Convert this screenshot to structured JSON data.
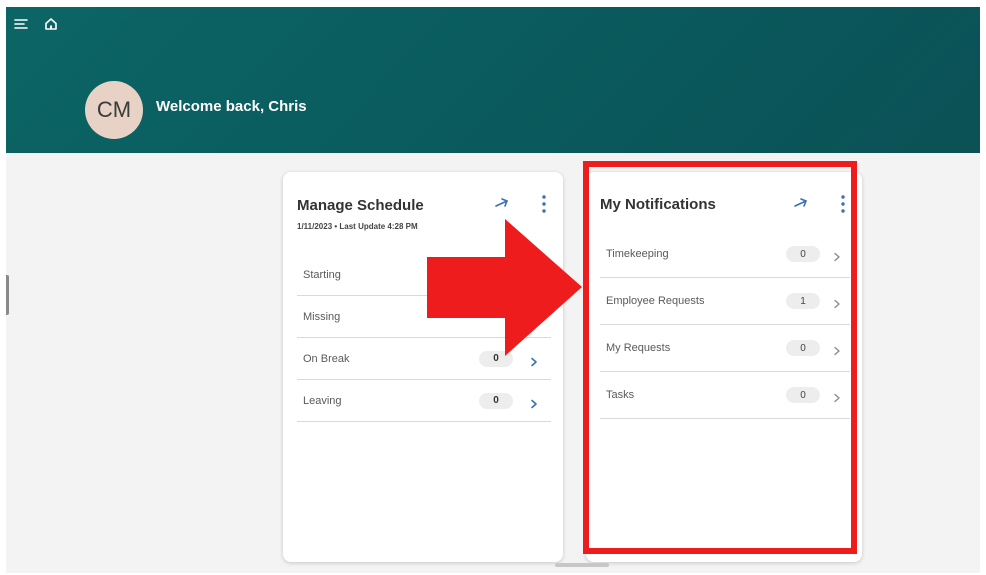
{
  "header": {
    "avatar_initials": "CM",
    "welcome_text": "Welcome back, Chris",
    "menu_icon": "menu-icon",
    "home_icon": "home-icon",
    "banner_color": "#0b5d60"
  },
  "manage_schedule": {
    "title": "Manage Schedule",
    "subtitle": "1/11/2023 • Last Update 4:28 PM",
    "rows": [
      {
        "label": "Starting"
      },
      {
        "label": "Missing"
      },
      {
        "label": "On Break",
        "count": "0"
      },
      {
        "label": "Leaving",
        "count": "0"
      }
    ]
  },
  "notifications": {
    "title": "My Notifications",
    "rows": [
      {
        "label": "Timekeeping",
        "count": "0"
      },
      {
        "label": "Employee Requests",
        "count": "1"
      },
      {
        "label": "My Requests",
        "count": "0"
      },
      {
        "label": "Tasks",
        "count": "0"
      }
    ]
  },
  "annotation": {
    "highlight_color": "#ee1c1c",
    "arrow_icon": "big-arrow-right-icon"
  }
}
